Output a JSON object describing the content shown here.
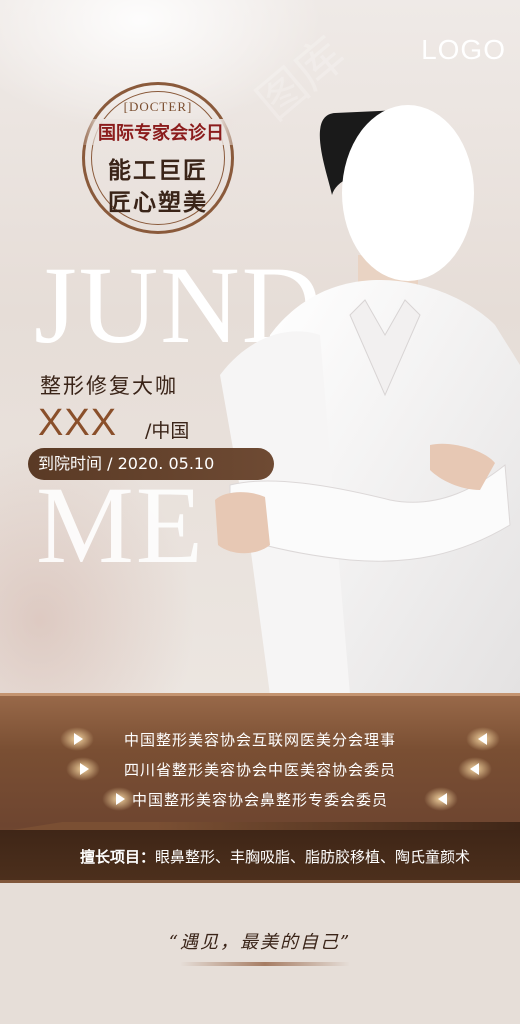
{
  "logo": "LOGO",
  "watermark": "图库",
  "seal": {
    "en": "[DOCTER]",
    "title": "国际专家会诊日",
    "line1": "能工巨匠",
    "line2": "匠心塑美"
  },
  "bg_words": [
    "JUND",
    "ME"
  ],
  "doctor": {
    "subtitle": "整形修复大咖",
    "name": "XXX",
    "country": "/中国",
    "visit_label": "到院时间",
    "visit_date": "/ 2020. 05.10"
  },
  "roles": [
    "中国整形美容协会互联网医美分会理事",
    "四川省整形美容协会中医美容协会委员",
    "中国整形美容协会鼻整形专委会委员"
  ],
  "skills": {
    "label": "擅长项目：",
    "text": "眼鼻整形、丰胸吸脂、脂肪胶移植、陶氏童颜术"
  },
  "slogan": "“遇见，最美的自己”",
  "colors": {
    "brand_brown": "#6e4530",
    "accent_red": "#8b1c1c",
    "dark_text": "#3a2418"
  }
}
